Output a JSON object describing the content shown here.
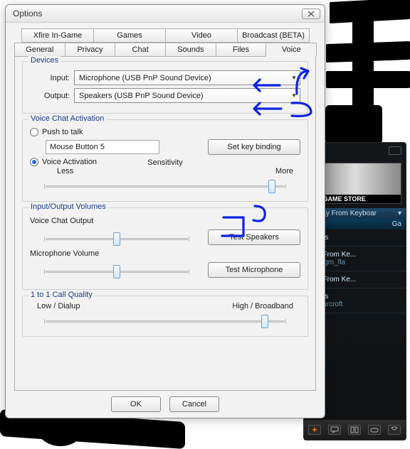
{
  "window": {
    "title": "Options",
    "tabs_top": [
      "Xfire In-Game",
      "Games",
      "Video",
      "Broadcast (BETA)"
    ],
    "tabs_bottom": [
      "General",
      "Privacy",
      "Chat",
      "Sounds",
      "Files",
      "Voice"
    ],
    "active_tab": "Voice",
    "ok": "OK",
    "cancel": "Cancel"
  },
  "devices": {
    "group": "Devices",
    "input_label": "Input:",
    "input_value": "Microphone (USB PnP Sound Device)",
    "output_label": "Output:",
    "output_value": "Speakers (USB PnP Sound Device)"
  },
  "activation": {
    "group": "Voice Chat Activation",
    "push_label": "Push to talk",
    "push_field": "Mouse Button 5",
    "keybind_btn": "Set key binding",
    "va_label": "Voice Activation",
    "sens_title": "Sensitivity",
    "sens_left": "Less",
    "sens_right": "More",
    "sens_pos": 0.96
  },
  "volumes": {
    "group": "Input/Output Volumes",
    "vco_label": "Voice Chat Output",
    "vco_pos": 0.5,
    "test_speakers": "Test Speakers",
    "mic_label": "Microphone Volume",
    "mic_pos": 0.5,
    "test_mic": "Test Microphone"
  },
  "quality": {
    "group": "1 to 1 Call Quality",
    "left": "Low / Dialup",
    "right": "High / Broadband",
    "pos": 0.93
  },
  "xfire": {
    "store_banner": "IRE GAME STORE",
    "away": ") Away From Keyboar",
    "header_right": "Ga",
    "items": [
      {
        "main": "t Arms"
      },
      {
        "main": "way From Ke...",
        "sub": "Mod    gm_fla"
      },
      {
        "main": "way From Ke..."
      },
      {
        "main": "t Arms",
        "sub": "of Warcroft"
      }
    ]
  },
  "annotations": [
    "1",
    "2",
    "3"
  ]
}
